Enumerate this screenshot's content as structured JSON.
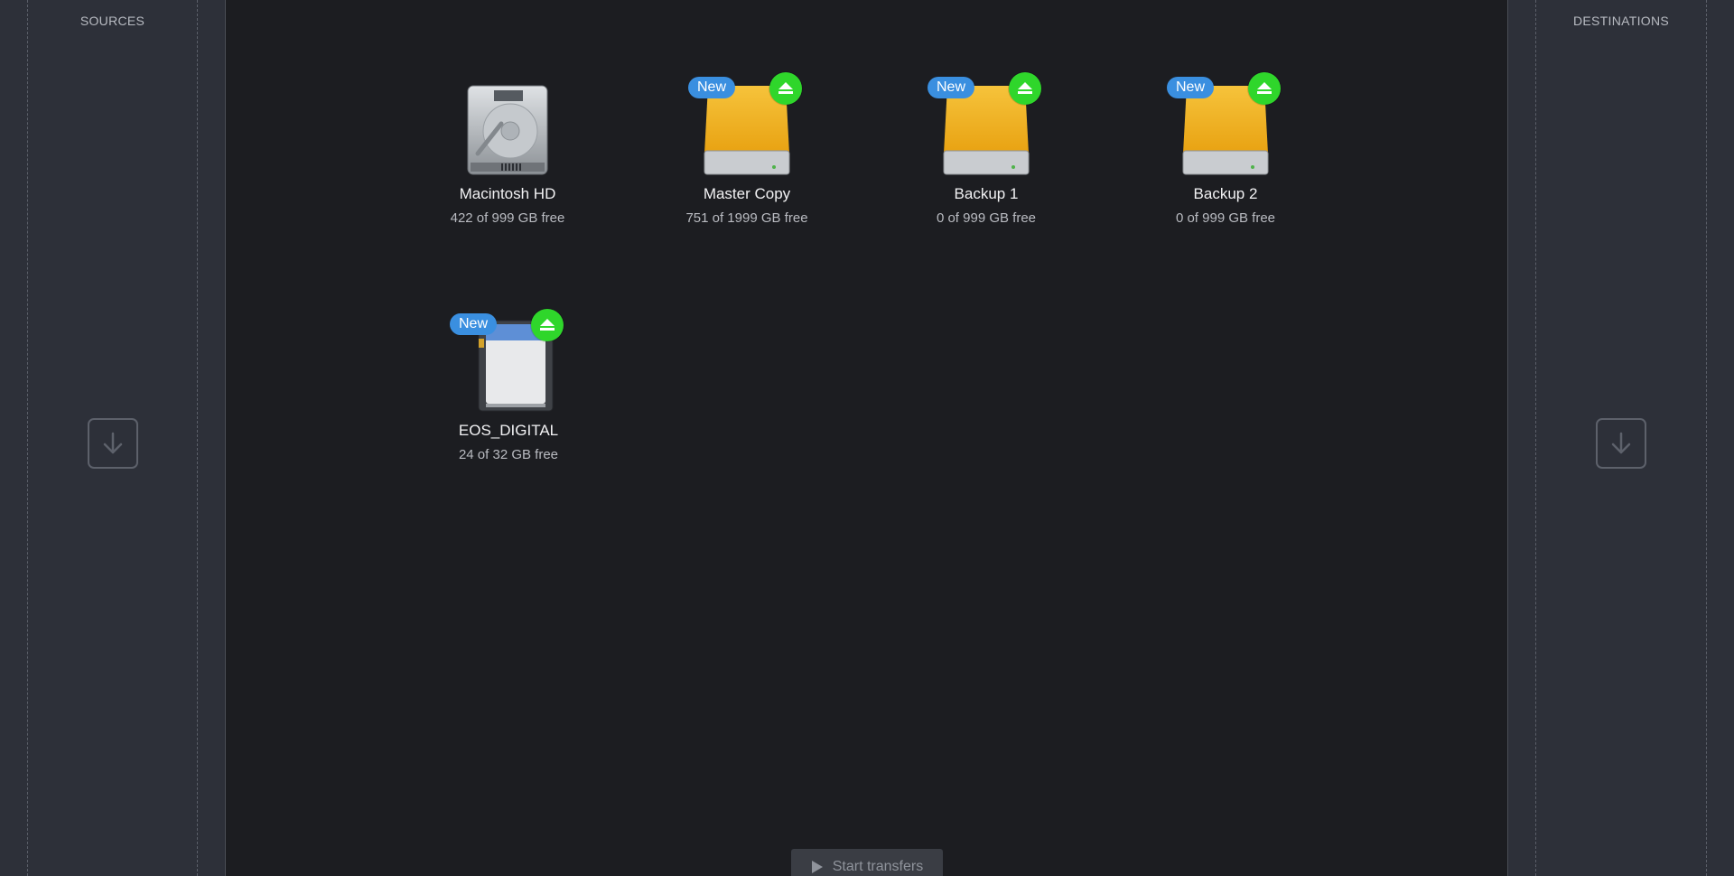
{
  "sources": {
    "title": "SOURCES"
  },
  "destinations": {
    "title": "DESTINATIONS"
  },
  "volumes": [
    {
      "name": "Macintosh HD",
      "free": "422 of 999 GB free",
      "badge": "",
      "icon": "internal-disk-icon"
    },
    {
      "name": "Master Copy",
      "free": "751 of 1999 GB free",
      "badge": "New",
      "icon": "external-disk-icon"
    },
    {
      "name": "Backup 1",
      "free": "0 of 999 GB free",
      "badge": "New",
      "icon": "external-disk-icon"
    },
    {
      "name": "Backup 2",
      "free": "0 of 999 GB free",
      "badge": "New",
      "icon": "external-disk-icon"
    },
    {
      "name": "EOS_DIGITAL",
      "free": "24 of 32 GB free",
      "badge": "New",
      "icon": "sd-card-icon"
    }
  ],
  "start_button": {
    "label": "Start transfers"
  },
  "colors": {
    "new_badge": "#3a8fe0",
    "eject": "#2fd62b",
    "external_disk": "#f0b01a",
    "panel": "#2d3039",
    "main": "#1c1d21"
  }
}
